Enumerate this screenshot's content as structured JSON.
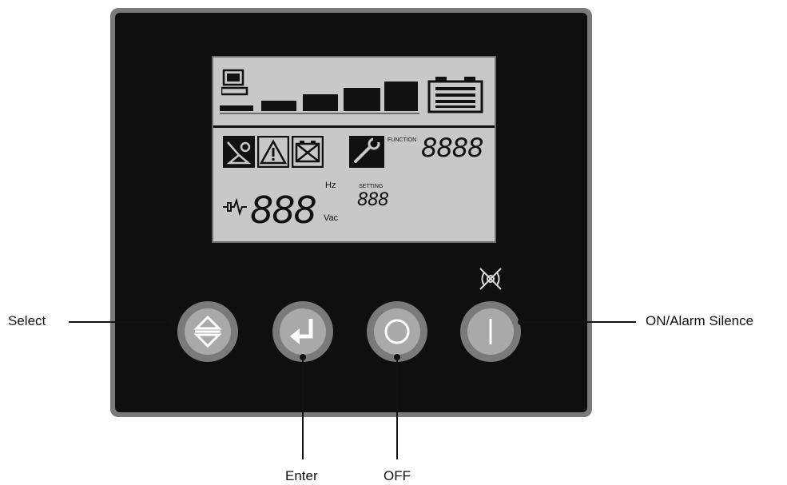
{
  "lcd": {
    "function_label": "FUNCTION",
    "function_digits": "8888",
    "hz_label": "Hz",
    "vac_label": "Vac",
    "main_digits": "888",
    "setting_label": "SETTING",
    "setting_digits": "888",
    "icons": [
      "computer-icon",
      "load-bar-icon",
      "battery-icon",
      "bypass-icon",
      "warning-icon",
      "battery-fault-icon",
      "wrench-icon",
      "ac-input-icon"
    ]
  },
  "buttons": [
    {
      "name": "select-button",
      "icon": "up-down-arrows-icon"
    },
    {
      "name": "enter-button",
      "icon": "enter-arrow-icon"
    },
    {
      "name": "off-button",
      "icon": "circle-icon"
    },
    {
      "name": "on-alarm-silence-button",
      "icon": "vertical-line-icon"
    }
  ],
  "alarm_silence_icon": "alarm-silenced-icon",
  "callouts": {
    "select": "Select",
    "enter": "Enter",
    "off": "OFF",
    "on_alarm_silence": "ON/Alarm Silence"
  }
}
